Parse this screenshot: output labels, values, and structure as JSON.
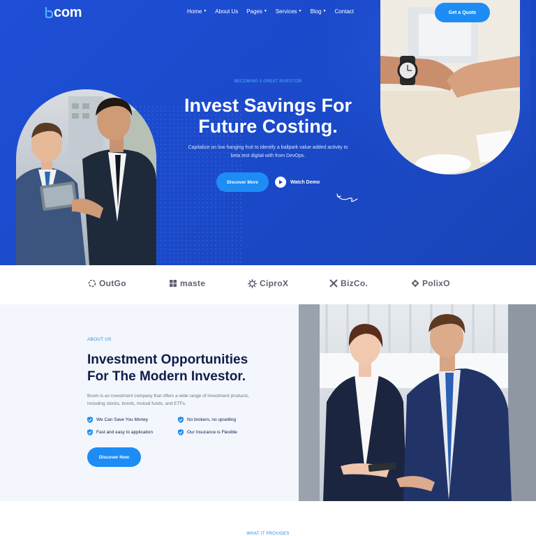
{
  "brand": {
    "name": "com",
    "logo_icon": "b-letter-icon"
  },
  "nav": {
    "items": [
      {
        "label": "Home",
        "has_dropdown": true
      },
      {
        "label": "About Us",
        "has_dropdown": false
      },
      {
        "label": "Pages",
        "has_dropdown": true
      },
      {
        "label": "Services",
        "has_dropdown": true
      },
      {
        "label": "Blog",
        "has_dropdown": true
      },
      {
        "label": "Contact",
        "has_dropdown": false
      }
    ],
    "cta_label": "Get a Quote"
  },
  "hero": {
    "eyebrow": "BECOMING A GREAT INVESTOR",
    "title": "Invest Savings For Future Costing.",
    "description": "Capitalize on low hanging fruit to identify a ballpark value added activity to beta test digital with from DevOps.",
    "primary_button": "Discover More",
    "secondary_button": "Watch Demo"
  },
  "partners": [
    {
      "name": "OutGo",
      "icon": "outgo-logo-icon"
    },
    {
      "name": "maste",
      "icon": "maste-logo-icon"
    },
    {
      "name": "CiproX",
      "icon": "ciprox-logo-icon"
    },
    {
      "name": "BizCo.",
      "icon": "bizco-logo-icon"
    },
    {
      "name": "PolixO",
      "icon": "polixo-logo-icon"
    }
  ],
  "about": {
    "eyebrow": "ABOUT US",
    "title_line1": "Investment Opportunities",
    "title_line2": "For The Modern Investor.",
    "description": "Bcom is an investment company that offers a wide range of investment products, including stocks, bonds, mutual funds, and ETFs.",
    "features": [
      "We Can Save You Money",
      "No brokers, no upselling",
      "Fast and easy to application",
      "Our Insurance is Flexible"
    ],
    "button": "Discover Now"
  },
  "next_section": {
    "eyebrow": "WHAT IT PROVIDES"
  },
  "colors": {
    "hero_blue": "#1a49c8",
    "accent": "#1d8df5",
    "heading": "#0f1d4a",
    "about_bg": "#f3f6fc"
  }
}
